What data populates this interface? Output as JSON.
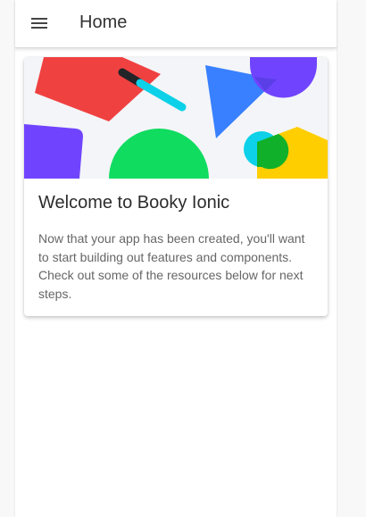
{
  "header": {
    "title": "Home",
    "menu_icon": "menu-icon"
  },
  "card": {
    "image_icon": "abstract-shapes-illustration",
    "title": "Welcome to Booky Ionic",
    "text": "Now that your app has been created, you'll want to start building out features and components. Check out some of the resources below for next steps."
  },
  "colors": {
    "toolbar_bg": "#ffffff",
    "card_image_bg": "#f4f5f8",
    "red": "#f04141",
    "blue": "#3880ff",
    "purple": "#7044ff",
    "green": "#10dc60",
    "cyan": "#0cd1e8",
    "yellow": "#ffce00"
  }
}
